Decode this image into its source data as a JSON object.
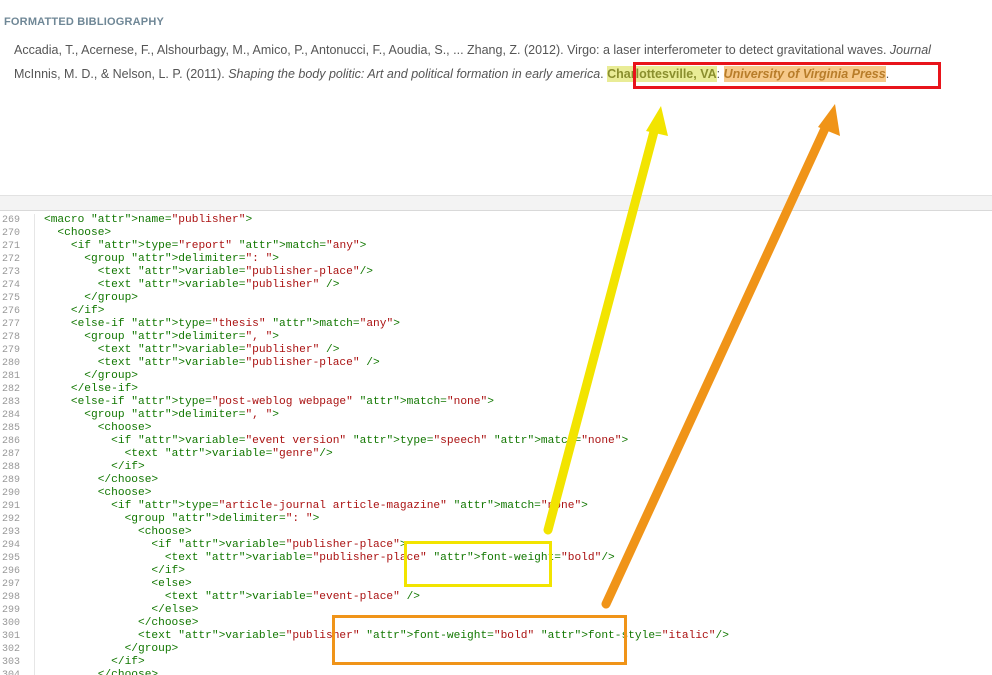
{
  "bibliography": {
    "header": "FORMATTED BIBLIOGRAPHY",
    "entry1": {
      "text": "Accadia, T., Acernese, F., Alshourbagy, M., Amico, P., Antonucci, F., Aoudia, S., ... Zhang, Z. (2012). Virgo: a laser interferometer to detect gravitational waves. ",
      "journal": "Journal"
    },
    "entry2": {
      "authors": "McInnis, M. D., & Nelson, L. P. (2011). ",
      "title": "Shaping the body politic: Art and political formation in early america",
      "sep": ". ",
      "place": "Charlottesville, VA",
      "colon": ": ",
      "publisher": "University of Virginia Press",
      "end": "."
    }
  },
  "code_lines": [
    {
      "n": "269",
      "t": "<macro name=\"publisher\">"
    },
    {
      "n": "270",
      "t": "  <choose>"
    },
    {
      "n": "271",
      "t": "    <if type=\"report\" match=\"any\">"
    },
    {
      "n": "272",
      "t": "      <group delimiter=\": \">"
    },
    {
      "n": "273",
      "t": "        <text variable=\"publisher-place\"/>"
    },
    {
      "n": "274",
      "t": "        <text variable=\"publisher\" />"
    },
    {
      "n": "275",
      "t": "      </group>"
    },
    {
      "n": "276",
      "t": "    </if>"
    },
    {
      "n": "277",
      "t": "    <else-if type=\"thesis\" match=\"any\">"
    },
    {
      "n": "278",
      "t": "      <group delimiter=\", \">"
    },
    {
      "n": "279",
      "t": "        <text variable=\"publisher\" />"
    },
    {
      "n": "280",
      "t": "        <text variable=\"publisher-place\" />"
    },
    {
      "n": "281",
      "t": "      </group>"
    },
    {
      "n": "282",
      "t": "    </else-if>"
    },
    {
      "n": "283",
      "t": "    <else-if type=\"post-weblog webpage\" match=\"none\">"
    },
    {
      "n": "284",
      "t": "      <group delimiter=\", \">"
    },
    {
      "n": "285",
      "t": "        <choose>"
    },
    {
      "n": "286",
      "t": "          <if variable=\"event version\" type=\"speech\" match=\"none\">"
    },
    {
      "n": "287",
      "t": "            <text variable=\"genre\"/>"
    },
    {
      "n": "288",
      "t": "          </if>"
    },
    {
      "n": "289",
      "t": "        </choose>"
    },
    {
      "n": "290",
      "t": "        <choose>"
    },
    {
      "n": "291",
      "t": "          <if type=\"article-journal article-magazine\" match=\"none\">"
    },
    {
      "n": "292",
      "t": "            <group delimiter=\": \">"
    },
    {
      "n": "293",
      "t": "              <choose>"
    },
    {
      "n": "294",
      "t": "                <if variable=\"publisher-place\">"
    },
    {
      "n": "295",
      "t": "                  <text variable=\"publisher-place\" font-weight=\"bold\"/>"
    },
    {
      "n": "296",
      "t": "                </if>"
    },
    {
      "n": "297",
      "t": "                <else>"
    },
    {
      "n": "298",
      "t": "                  <text variable=\"event-place\" />"
    },
    {
      "n": "299",
      "t": "                </else>"
    },
    {
      "n": "300",
      "t": "              </choose>"
    },
    {
      "n": "301",
      "t": "              <text variable=\"publisher\" font-weight=\"bold\" font-style=\"italic\"/>"
    },
    {
      "n": "302",
      "t": "            </group>"
    },
    {
      "n": "303",
      "t": "          </if>"
    },
    {
      "n": "304",
      "t": "        </choose>"
    }
  ],
  "colors": {
    "red_box": "#e8141b",
    "yellow_arrow": "#f2e400",
    "orange_arrow": "#f09418"
  }
}
